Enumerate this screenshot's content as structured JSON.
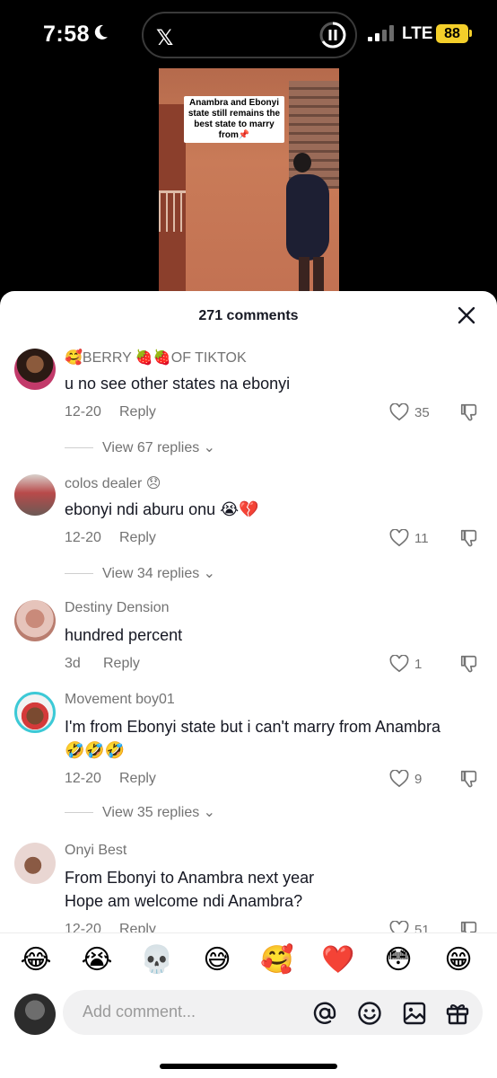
{
  "status_bar": {
    "time": "7:58",
    "carrier": "LTE",
    "battery": "88",
    "island_app": "𝕏"
  },
  "video": {
    "caption": "Anambra and Ebonyi state still remains the best state to marry from📌"
  },
  "sheet": {
    "comment_count": "271 comments",
    "comments": [
      {
        "username": "🥰BERRY 🍓🍓OF TIKTOK",
        "text": "u no see other states na ebonyi",
        "date": "12-20",
        "reply_label": "Reply",
        "likes": "35",
        "view_replies": "View 67 replies"
      },
      {
        "username": "colos dealer 😞",
        "text": "ebonyi ndi aburu onu 😭💔",
        "date": "12-20",
        "reply_label": "Reply",
        "likes": "11",
        "view_replies": "View 34 replies"
      },
      {
        "username": "Destiny Dension",
        "text": "hundred percent",
        "date": "3d",
        "reply_label": "Reply",
        "likes": "1"
      },
      {
        "username": "Movement boy01",
        "text": "I'm from Ebonyi state but i can't marry from Anambra 🤣🤣🤣",
        "date": "12-20",
        "reply_label": "Reply",
        "likes": "9",
        "view_replies": "View 35 replies"
      },
      {
        "username": "Onyi Best",
        "text": "From Ebonyi to Anambra next year\nHope am welcome ndi Anambra?",
        "date": "12-20",
        "reply_label": "Reply",
        "likes": "51"
      }
    ]
  },
  "emoji_bar": [
    "😂",
    "😭",
    "💀",
    "😅",
    "🥰",
    "❤️",
    "😳",
    "😁"
  ],
  "input": {
    "placeholder": "Add comment..."
  },
  "colors": {
    "text_primary": "#161823",
    "text_secondary": "#737373",
    "battery": "#f4cf2a"
  }
}
